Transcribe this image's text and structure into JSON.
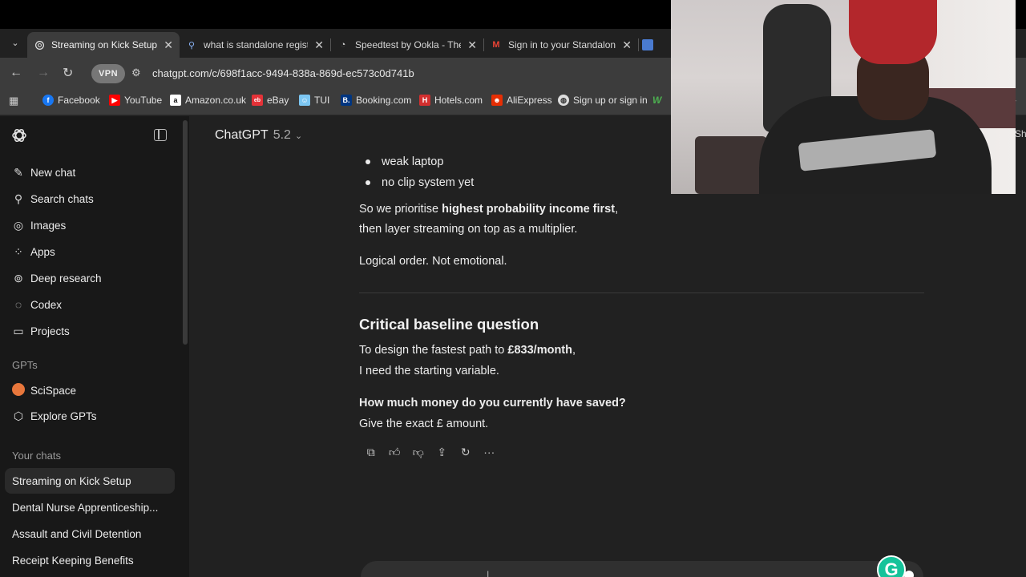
{
  "browser": {
    "tabs": [
      {
        "title": "Streaming on Kick Setup",
        "icon": "chatgpt-icon",
        "active": true
      },
      {
        "title": "what is standalone registra",
        "icon": "search-icon",
        "active": false
      },
      {
        "title": "Speedtest by Ookla - The G",
        "icon": "speedtest-icon",
        "active": false
      },
      {
        "title": "Sign in to your Standalone",
        "icon": "gmail-icon",
        "active": false
      }
    ],
    "vpn_label": "VPN",
    "url": "chatgpt.com/c/698f1acc-9494-838a-869d-ec573c0d741b",
    "bookmarks": [
      {
        "label": "Facebook",
        "icon": "facebook-icon",
        "color": "#1877f2"
      },
      {
        "label": "YouTube",
        "icon": "youtube-icon",
        "color": "#ff0000"
      },
      {
        "label": "Amazon.co.uk",
        "icon": "amazon-icon",
        "color": "#ffffff"
      },
      {
        "label": "eBay",
        "icon": "ebay-icon",
        "color": "#e53238"
      },
      {
        "label": "TUI",
        "icon": "tui-icon",
        "color": "#7cc6f2"
      },
      {
        "label": "Booking.com",
        "icon": "booking-icon",
        "color": "#003580"
      },
      {
        "label": "Hotels.com",
        "icon": "hotels-icon",
        "color": "#d32f2f"
      },
      {
        "label": "AliExpress",
        "icon": "aliexpress-icon",
        "color": "#e62e04"
      },
      {
        "label": "Sign up or sign in",
        "icon": "globe-icon",
        "color": "#cccccc"
      }
    ]
  },
  "sidebar": {
    "items": [
      {
        "label": "New chat",
        "icon": "edit-icon"
      },
      {
        "label": "Search chats",
        "icon": "search-icon"
      },
      {
        "label": "Images",
        "icon": "images-icon"
      },
      {
        "label": "Apps",
        "icon": "apps-icon"
      },
      {
        "label": "Deep research",
        "icon": "deep-research-icon"
      },
      {
        "label": "Codex",
        "icon": "codex-icon"
      },
      {
        "label": "Projects",
        "icon": "folder-icon"
      }
    ],
    "gpts_label": "GPTs",
    "gpts": [
      {
        "label": "SciSpace",
        "icon": "scispace-icon"
      },
      {
        "label": "Explore GPTs",
        "icon": "explore-icon"
      }
    ],
    "chats_label": "Your chats",
    "chats": [
      {
        "label": "Streaming on Kick Setup",
        "active": true
      },
      {
        "label": "Dental Nurse Apprenticeship...",
        "active": false
      },
      {
        "label": "Assault and Civil Detention",
        "active": false
      },
      {
        "label": "Receipt Keeping Benefits",
        "active": false
      }
    ]
  },
  "header": {
    "model": "ChatGPT",
    "version": "5.2"
  },
  "message": {
    "bullets": [
      "weak laptop",
      "no clip system yet"
    ],
    "p1_pre": "So we prioritise ",
    "p1_bold": "highest probability income first",
    "p1_post": ",",
    "p2": "then layer streaming on top as a multiplier.",
    "p3": "Logical order. Not emotional.",
    "heading": "Critical baseline question",
    "p4_pre": "To design the fastest path to ",
    "p4_bold": "£833/month",
    "p4_post": ",",
    "p5": "I need the starting variable.",
    "p6_bold": "How much money do you currently have saved?",
    "p7": "Give the exact £ amount."
  },
  "actions": [
    "copy-icon",
    "thumbs-up-icon",
    "thumbs-down-icon",
    "share-icon",
    "regenerate-icon",
    "more-icon"
  ],
  "colors": {
    "background": "#212121",
    "sidebar": "#181818",
    "grammarly": "#15c39a"
  }
}
